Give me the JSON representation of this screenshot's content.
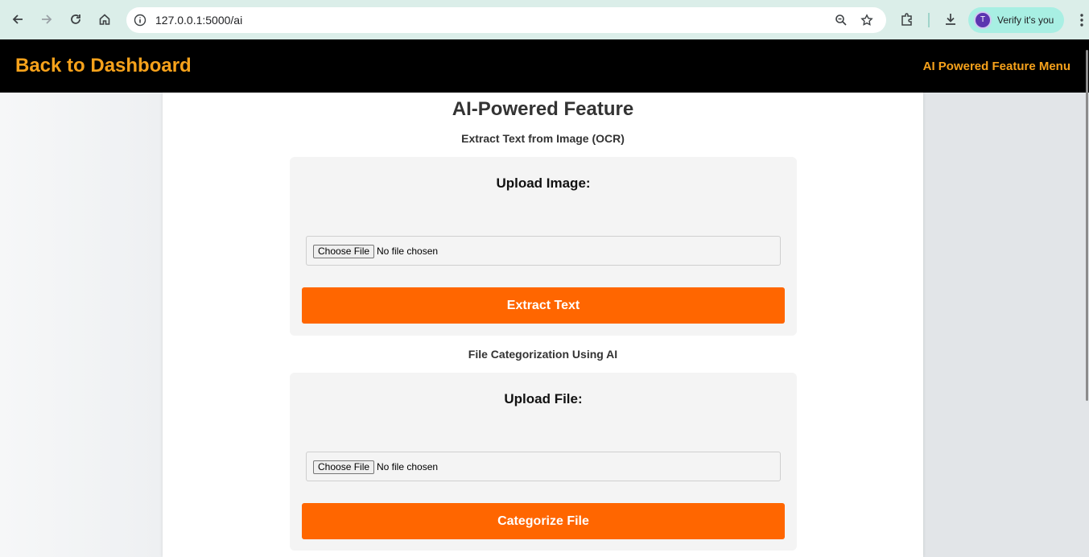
{
  "browser": {
    "url": "127.0.0.1:5000/ai",
    "verify_label": "Verify it's you",
    "avatar_letter": "T",
    "icons": [
      "back-arrow-icon",
      "forward-arrow-icon",
      "reload-icon",
      "home-icon",
      "site-info-icon",
      "zoom-icon",
      "bookmark-star-icon",
      "extensions-icon",
      "download-icon",
      "kebab-menu-icon"
    ]
  },
  "header": {
    "back_link": "Back to Dashboard",
    "menu_link": "AI Powered Feature Menu",
    "accent_color": "#f7a21b"
  },
  "main": {
    "title": "AI-Powered Feature",
    "sections": [
      {
        "subtitle": "Extract Text from Image (OCR)",
        "upload_label": "Upload Image:",
        "choose_file": "Choose File",
        "file_status": "No file chosen",
        "action_label": "Extract Text"
      },
      {
        "subtitle": "File Categorization Using AI",
        "upload_label": "Upload File:",
        "choose_file": "Choose File",
        "file_status": "No file chosen",
        "action_label": "Categorize File"
      }
    ],
    "button_color": "#ff6600"
  }
}
